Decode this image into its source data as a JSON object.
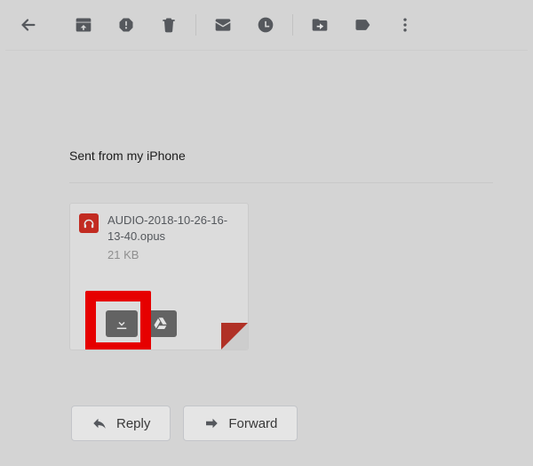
{
  "toolbar": {
    "back": "Back",
    "archive": "Archive",
    "spam": "Report spam",
    "delete": "Delete",
    "mark_unread": "Mark as unread",
    "snooze": "Snooze",
    "move_to": "Move to",
    "labels": "Labels",
    "more": "More"
  },
  "email": {
    "body_text": "Sent from my iPhone"
  },
  "attachment": {
    "filename": "AUDIO-2018-10-26-16-13-40.opus",
    "size": "21 KB",
    "download_label": "Download",
    "save_drive_label": "Save to Drive"
  },
  "actions": {
    "reply_label": "Reply",
    "forward_label": "Forward"
  }
}
